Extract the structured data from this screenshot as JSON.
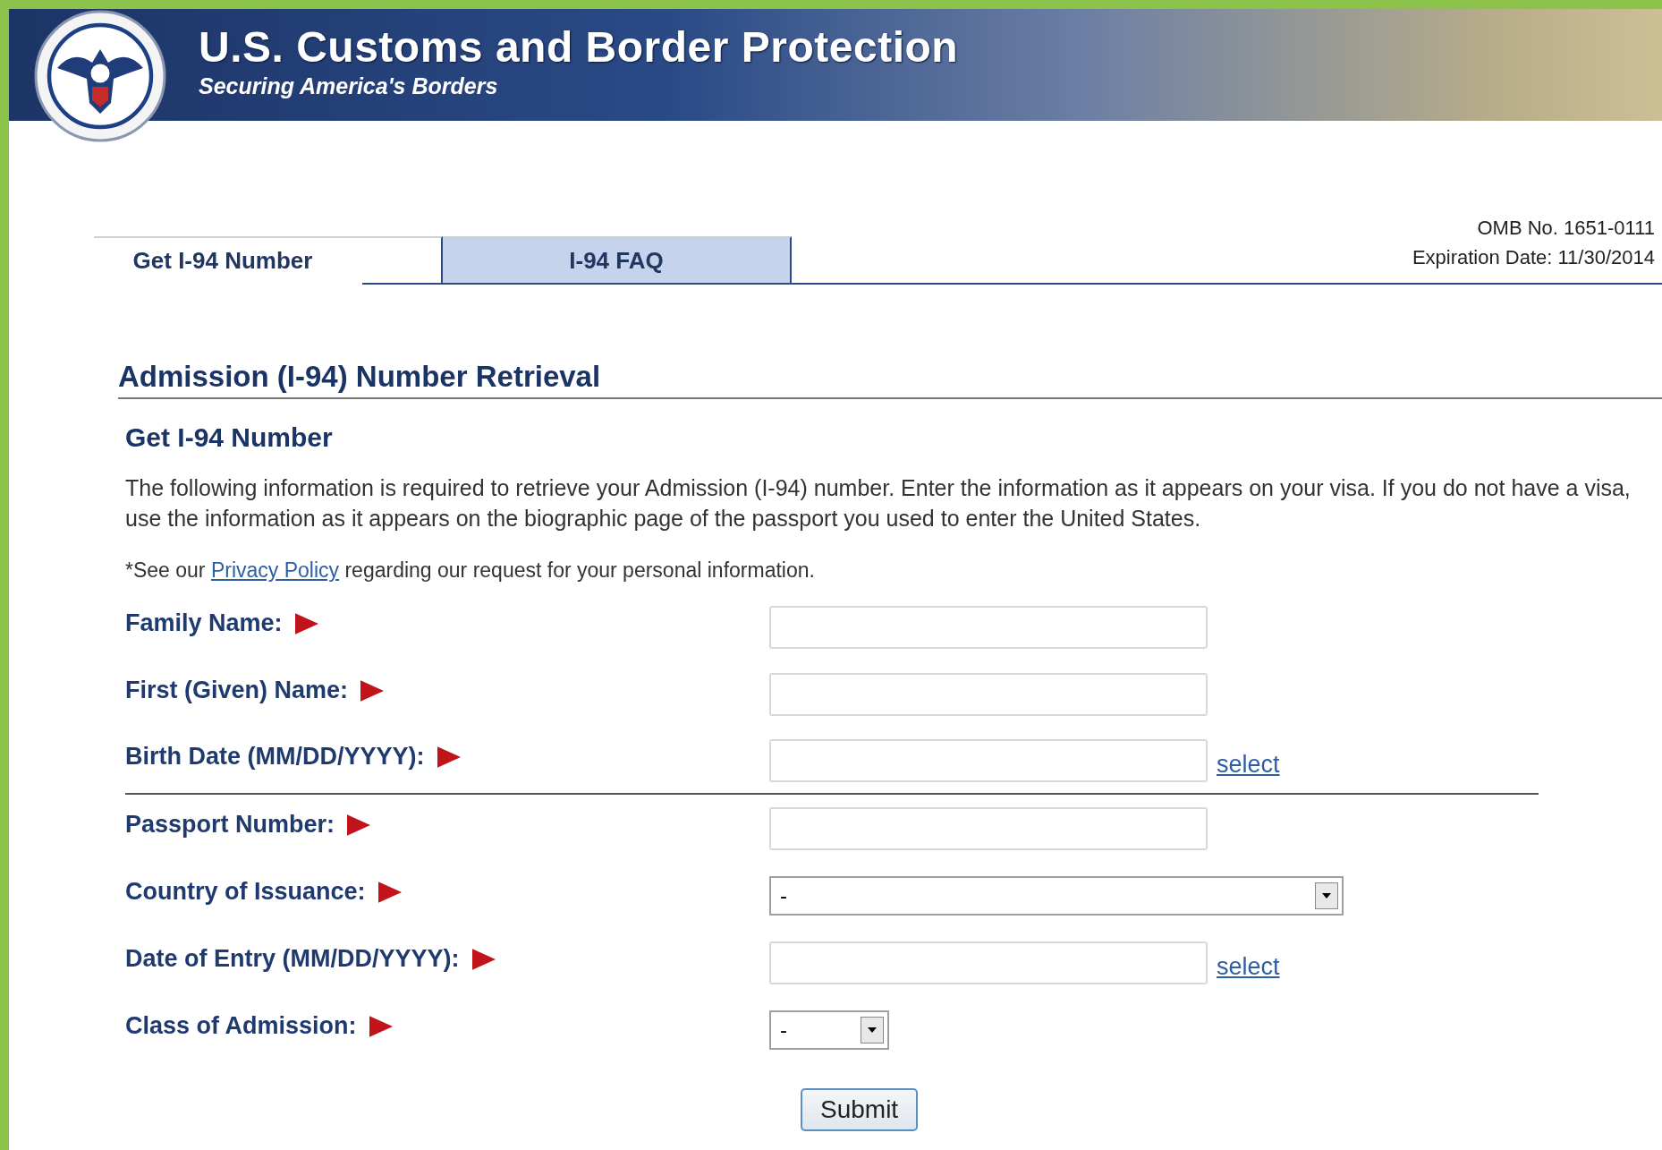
{
  "header": {
    "title": "U.S. Customs and Border Protection",
    "subtitle": "Securing America's Borders"
  },
  "tabs": [
    {
      "label": "Get I-94 Number",
      "selected": true
    },
    {
      "label": "I-94 FAQ",
      "selected": false
    }
  ],
  "omb": {
    "number": "OMB No. 1651-0111",
    "expiration": "Expiration Date: 11/30/2014"
  },
  "page_title": "Admission (I-94) Number Retrieval",
  "section_title": "Get I-94 Number",
  "intro": "The following information is required to retrieve your Admission (I-94) number. Enter the information as it appears on your visa. If you do not have a visa, use the information as it appears on the biographic page of the passport you used to enter the United States.",
  "privacy": {
    "before": "*See our",
    "link": "Privacy Policy",
    "after": "regarding our request for your personal information."
  },
  "fields": [
    {
      "label": "Family Name:",
      "kind": "text"
    },
    {
      "label": "First (Given) Name:",
      "kind": "text"
    },
    {
      "label": "Birth Date (MM/DD/YYYY):",
      "kind": "date",
      "link": "select"
    },
    {
      "label": "Passport Number:",
      "kind": "text"
    },
    {
      "label": "Country of Issuance:",
      "kind": "select_wide",
      "value": "-"
    },
    {
      "label": "Date of Entry (MM/DD/YYYY):",
      "kind": "date",
      "link": "select"
    },
    {
      "label": "Class of Admission:",
      "kind": "select_small",
      "value": "-"
    }
  ],
  "submit": "Submit"
}
